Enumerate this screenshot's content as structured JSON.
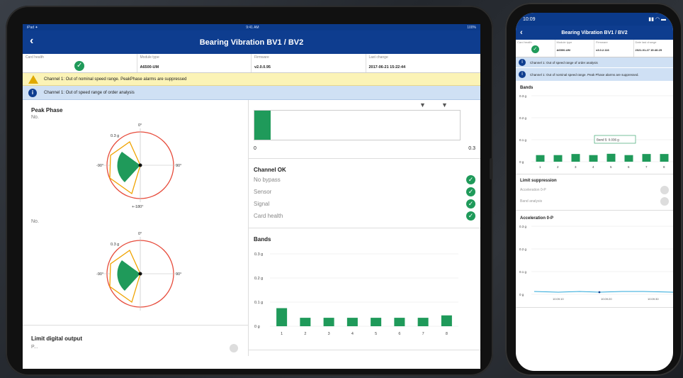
{
  "tablet": {
    "status": {
      "left": "iPad ✦",
      "center": "9:41 AM",
      "right": "100%"
    },
    "title": "Bearing Vibration BV1 / BV2",
    "back_glyph": "‹",
    "info": [
      {
        "label": "Card health",
        "value": ""
      },
      {
        "label": "Module type",
        "value": "A6500-UM"
      },
      {
        "label": "Firmware",
        "value": "v2.0.0.95"
      },
      {
        "label": "Last change",
        "value": "2017-06-21 15:22:44"
      }
    ],
    "warning": "Channel 1: Out of nominal speed range. PeakPhase alarms are suppressed",
    "info_banner": "Channel 1: Out of speed range of order analysis",
    "peak_phase": {
      "title": "Peak Phase",
      "sub1": "No.",
      "sub2": "No.",
      "top_label": "0°",
      "right_label": "90°",
      "left_label": "-90°",
      "bottom_label": "+-180°",
      "scale_label": "0.3 g"
    },
    "limit_title": "Limit digital output",
    "limit_sub": "P...",
    "bar": {
      "min": "0",
      "max": "0.3",
      "fill": 0.08,
      "color": "#1f9a5a"
    },
    "channel": {
      "title": "Channel OK",
      "items": [
        "No bypass",
        "Sensor",
        "Signal",
        "Card health"
      ]
    },
    "bands": {
      "title": "Bands",
      "ylabels": [
        "0.3 g",
        "0.2 g",
        "0.1 g",
        "0 g"
      ]
    }
  },
  "phone": {
    "time": "10:09",
    "title": "Bearing Vibration BV1 / BV2",
    "info": [
      {
        "label": "Card health",
        "value": ""
      },
      {
        "label": "Module type",
        "value": "A6500-UM"
      },
      {
        "label": "Firmware",
        "value": "v3.0.2.116"
      },
      {
        "label": "Date last change",
        "value": "2021-01-27 15:46:25"
      }
    ],
    "banner1": "Channel 1: Out of speed range of order analysis",
    "banner2": "Channel 1: Out of nominal speed range. Peak Phase alarms are suppressed.",
    "bands_title": "Bands",
    "bands_ylabels": [
      "0.3 g",
      "0.2 g",
      "0.1 g",
      "0 g"
    ],
    "tooltip": "Band 5: 0.036 g",
    "limit_title": "Limit suppression",
    "limit_items": [
      "Acceleration 0-P",
      "Band analysis"
    ],
    "accel_title": "Acceleration 0-P",
    "accel_ylabels": [
      "0.3 g",
      "0.2 g",
      "0.1 g",
      "0 g"
    ],
    "accel_xlabels": [
      "10:09:10",
      "10:09:20",
      "10:09:30"
    ]
  },
  "chart_data": [
    {
      "type": "bar",
      "title": "Bands",
      "categories": [
        "1",
        "2",
        "3",
        "4",
        "5",
        "6",
        "7",
        "8"
      ],
      "values": [
        0.075,
        0.035,
        0.035,
        0.035,
        0.035,
        0.035,
        0.035,
        0.045
      ],
      "ylim": [
        0,
        0.3
      ],
      "color": "#1f9a5a"
    },
    {
      "type": "bar",
      "title": "Bands",
      "categories": [
        "1",
        "2",
        "3",
        "4",
        "5",
        "6",
        "7",
        "8"
      ],
      "values": [
        0.03,
        0.03,
        0.035,
        0.03,
        0.036,
        0.03,
        0.035,
        0.035
      ],
      "ylim": [
        0,
        0.3
      ],
      "color": "#1f9a5a"
    }
  ]
}
